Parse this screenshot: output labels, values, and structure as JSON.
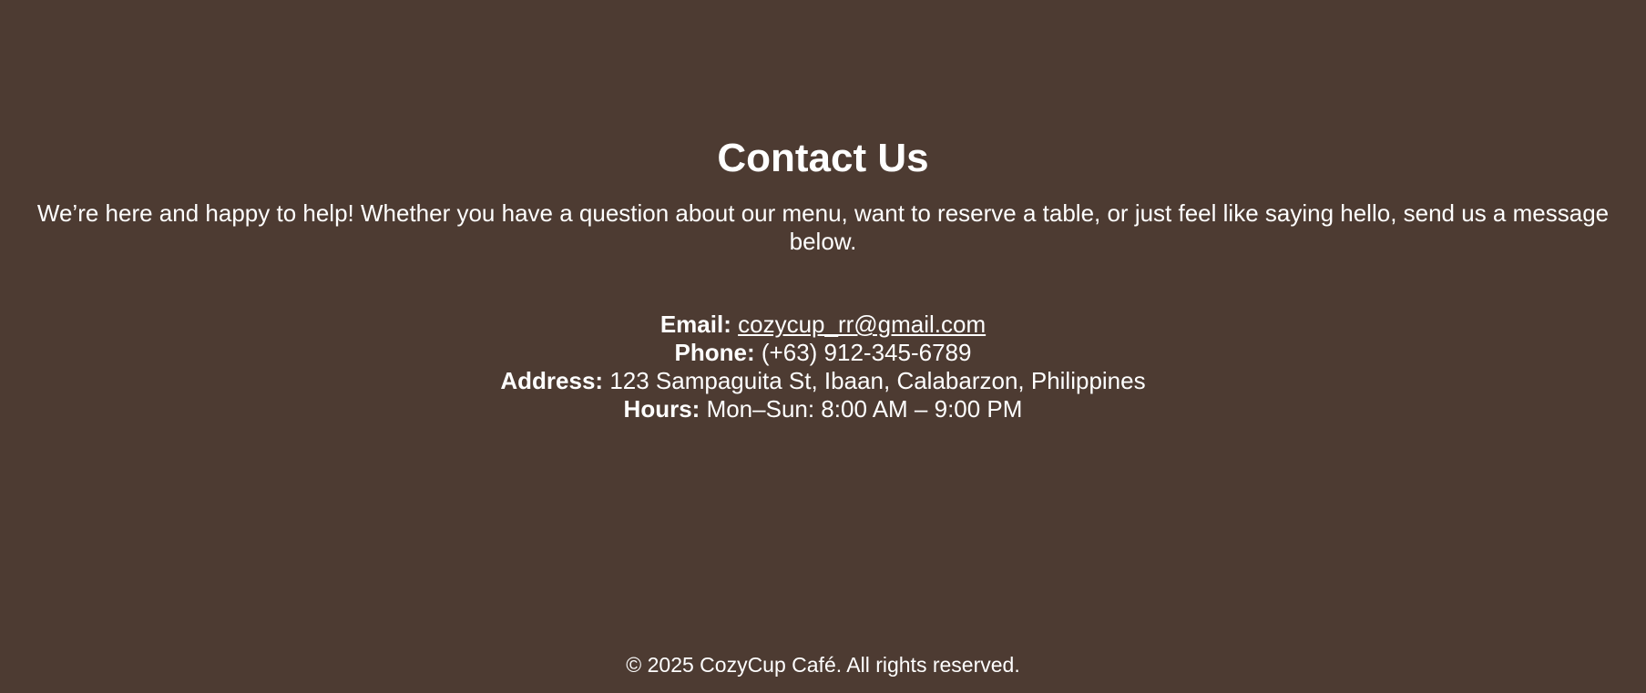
{
  "contact": {
    "title": "Contact Us",
    "intro": "We’re here and happy to help! Whether you have a question about our menu, want to reserve a table, or just feel like saying hello, send us a message below.",
    "email_label": "Email:",
    "email_value": "cozycup_rr@gmail.com",
    "phone_label": "Phone:",
    "phone_value": "(+63) 912-345-6789",
    "address_label": "Address:",
    "address_value": "123 Sampaguita St, Ibaan, Calabarzon, Philippines",
    "hours_label": "Hours:",
    "hours_value": "Mon–Sun: 8:00 AM – 9:00 PM"
  },
  "footer": {
    "copyright": "© 2025 CozyCup Café. All rights reserved."
  },
  "colors": {
    "background": "#4d3b32",
    "text": "#ffffff"
  }
}
